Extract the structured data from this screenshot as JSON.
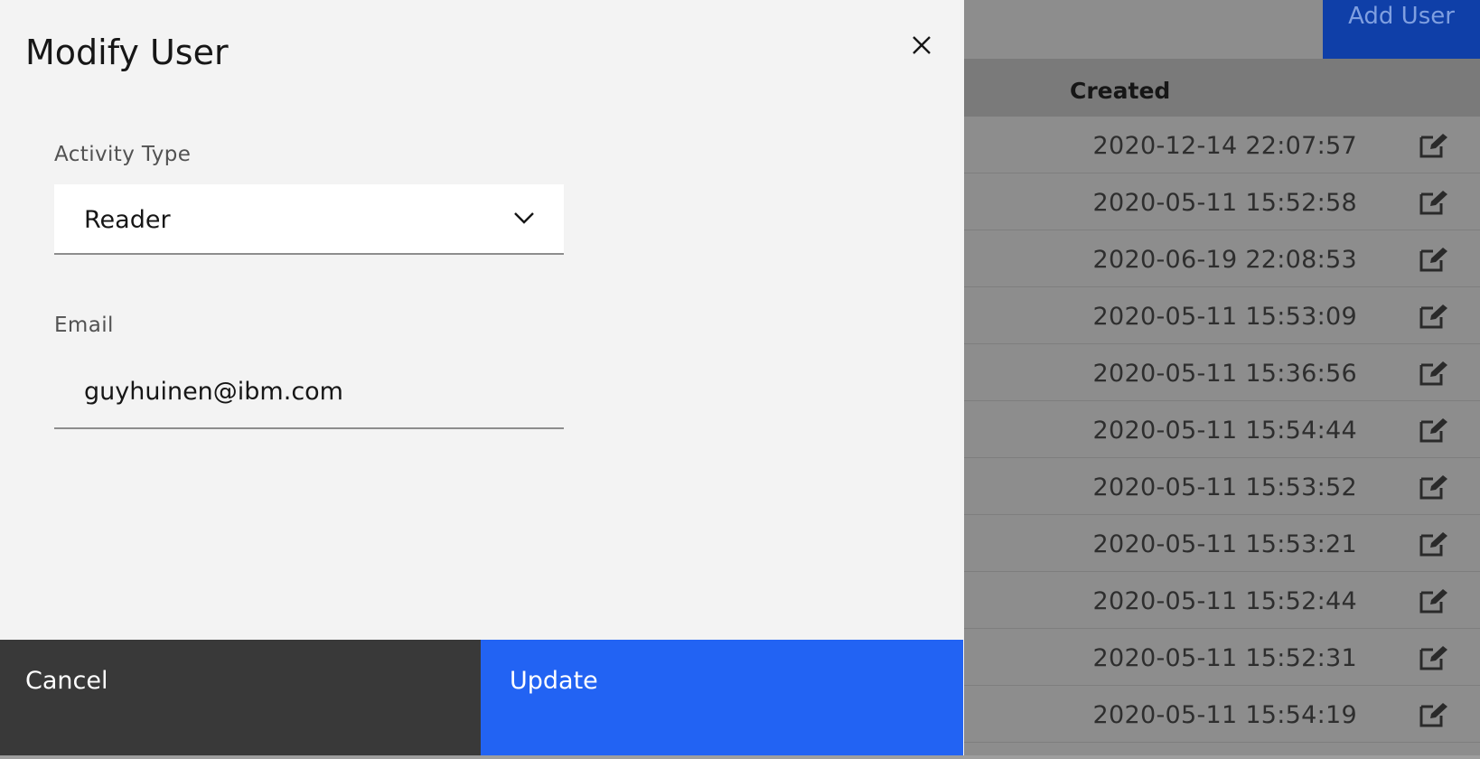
{
  "background": {
    "add_user_label": "Add User",
    "table": {
      "column_created": "Created",
      "rows": [
        "2020-12-14 22:07:57",
        "2020-05-11 15:52:58",
        "2020-06-19 22:08:53",
        "2020-05-11 15:53:09",
        "2020-05-11 15:36:56",
        "2020-05-11 15:54:44",
        "2020-05-11 15:53:52",
        "2020-05-11 15:53:21",
        "2020-05-11 15:52:44",
        "2020-05-11 15:52:31",
        "2020-05-11 15:54:19"
      ],
      "row_icon": "edit-icon"
    }
  },
  "modal": {
    "title": "Modify User",
    "close_icon": "close-icon",
    "activity_type": {
      "label": "Activity Type",
      "selected": "Reader",
      "icon": "chevron-down-icon"
    },
    "email": {
      "label": "Email",
      "value": "guyhuinen@ibm.com"
    },
    "buttons": {
      "cancel": "Cancel",
      "update": "Update"
    }
  },
  "colors": {
    "primary": "#2263f3",
    "secondary": "#393939",
    "overlay": "#8d8d8d",
    "panel": "#f3f3f3"
  }
}
